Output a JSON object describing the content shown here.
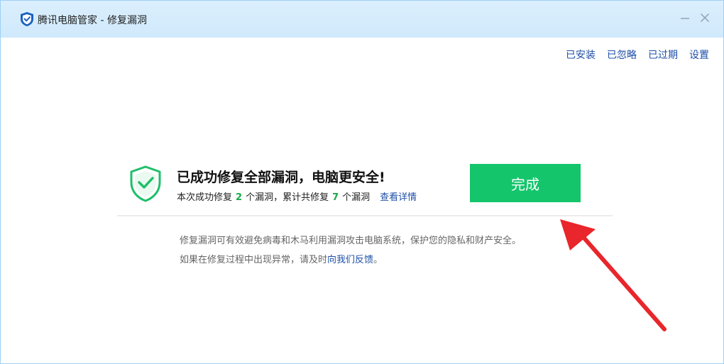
{
  "window": {
    "title": "腾讯电脑管家 - 修复漏洞",
    "minimize_label": "—",
    "close_label": "✕"
  },
  "toplinks": [
    {
      "label": "已安装"
    },
    {
      "label": "已忽略"
    },
    {
      "label": "已过期"
    },
    {
      "label": "设置"
    }
  ],
  "result": {
    "headline": "已成功修复全部漏洞，电脑更安全!",
    "sub_prefix": "本次成功修复",
    "fixed_count": "2",
    "sub_mid": "个漏洞，累计共修复",
    "total_count": "7",
    "sub_suffix": "个漏洞",
    "detail_link": "查看详情"
  },
  "done_button": "完成",
  "info": {
    "line1": "修复漏洞可有效避免病毒和木马利用漏洞攻击电脑系统，保护您的隐私和财产安全。",
    "line2_prefix": "如果在修复过程中出现异常，请及时",
    "feedback_link": "向我们反馈",
    "line2_suffix": "。"
  },
  "colors": {
    "accent_green": "#14c56b",
    "link_blue": "#1e4fa8",
    "arrow_red": "#e8262b",
    "titlebar_bg": "#d4ecfc"
  },
  "icons": {
    "app_logo": "tencent-shield-icon",
    "result_icon": "shield-check-icon"
  }
}
